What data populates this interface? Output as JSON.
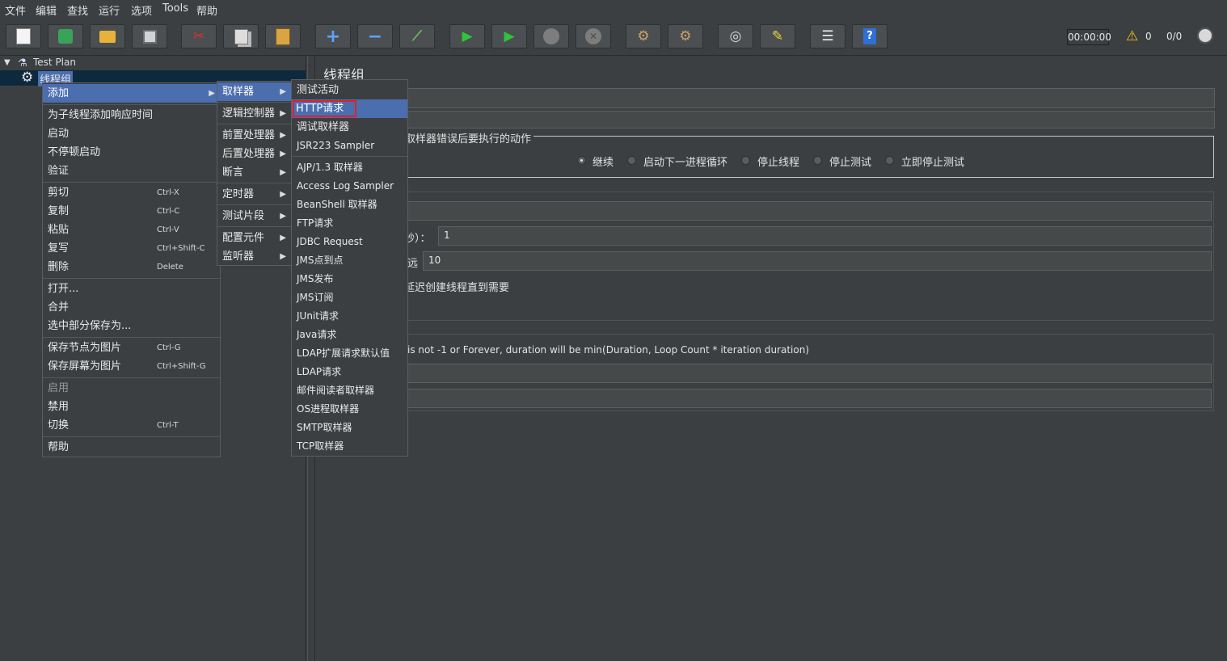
{
  "menubar": [
    "文件",
    "编辑",
    "查找",
    "运行",
    "选项",
    "Tools",
    "帮助"
  ],
  "toolbar": {
    "icons": [
      "new-icon",
      "templates-icon",
      "open-icon",
      "save-icon",
      "cut-icon",
      "copy-icon",
      "paste-icon",
      "expand-icon",
      "collapse-icon",
      "toggle-icon",
      "start-icon",
      "start-no-pause-icon",
      "stop-icon",
      "shutdown-icon",
      "clear-icon",
      "clear-all-icon",
      "search-icon",
      "reset-search-icon",
      "function-helper-icon",
      "help-icon"
    ],
    "timer": "00:00:00",
    "warning_count": "0",
    "threads": "0/0"
  },
  "tree": {
    "root": "Test Plan",
    "child": "线程组"
  },
  "right": {
    "title": "线程组",
    "action_label": "取样器错误后要执行的动作",
    "radios": [
      "继续",
      "启动下一进程循环",
      "停止线程",
      "停止测试",
      "立即停止测试"
    ],
    "ramp_suffix": "秒）：",
    "ramp_value": "1",
    "loop_suffix": "远",
    "loop_value": "10",
    "delay_suffix": "延迟创建线程直到需要",
    "duration_note": "is not -1 or Forever, duration will be min(Duration, Loop Count * iteration duration)"
  },
  "context_menu": {
    "items": [
      {
        "label": "添加"
      },
      {
        "label": "为子线程添加响应时间"
      },
      {
        "label": "启动"
      },
      {
        "label": "不停顿启动"
      },
      {
        "label": "验证"
      },
      {
        "label": "剪切",
        "shortcut": "Ctrl-X"
      },
      {
        "label": "复制",
        "shortcut": "Ctrl-C"
      },
      {
        "label": "粘贴",
        "shortcut": "Ctrl-V"
      },
      {
        "label": "复写",
        "shortcut": "Ctrl+Shift-C"
      },
      {
        "label": "删除",
        "shortcut": "Delete"
      },
      {
        "label": "打开..."
      },
      {
        "label": "合并"
      },
      {
        "label": "选中部分保存为..."
      },
      {
        "label": "保存节点为图片",
        "shortcut": "Ctrl-G"
      },
      {
        "label": "保存屏幕为图片",
        "shortcut": "Ctrl+Shift-G"
      },
      {
        "label": "启用"
      },
      {
        "label": "禁用"
      },
      {
        "label": "切换",
        "shortcut": "Ctrl-T"
      },
      {
        "label": "帮助"
      }
    ]
  },
  "add_menu": [
    "取样器",
    "逻辑控制器",
    "前置处理器",
    "后置处理器",
    "断言",
    "定时器",
    "测试片段",
    "配置元件",
    "监听器"
  ],
  "sampler_menu": [
    "测试活动",
    "HTTP请求",
    "调试取样器",
    "JSR223 Sampler",
    "AJP/1.3 取样器",
    "Access Log Sampler",
    "BeanShell 取样器",
    "FTP请求",
    "JDBC Request",
    "JMS点到点",
    "JMS发布",
    "JMS订阅",
    "JUnit请求",
    "Java请求",
    "LDAP扩展请求默认值",
    "LDAP请求",
    "邮件阅读者取样器",
    "OS进程取样器",
    "SMTP取样器",
    "TCP取样器"
  ],
  "colors": {
    "selection": "#4b6eaf",
    "highlight_border": "#e0202a",
    "background": "#3c3f41"
  }
}
